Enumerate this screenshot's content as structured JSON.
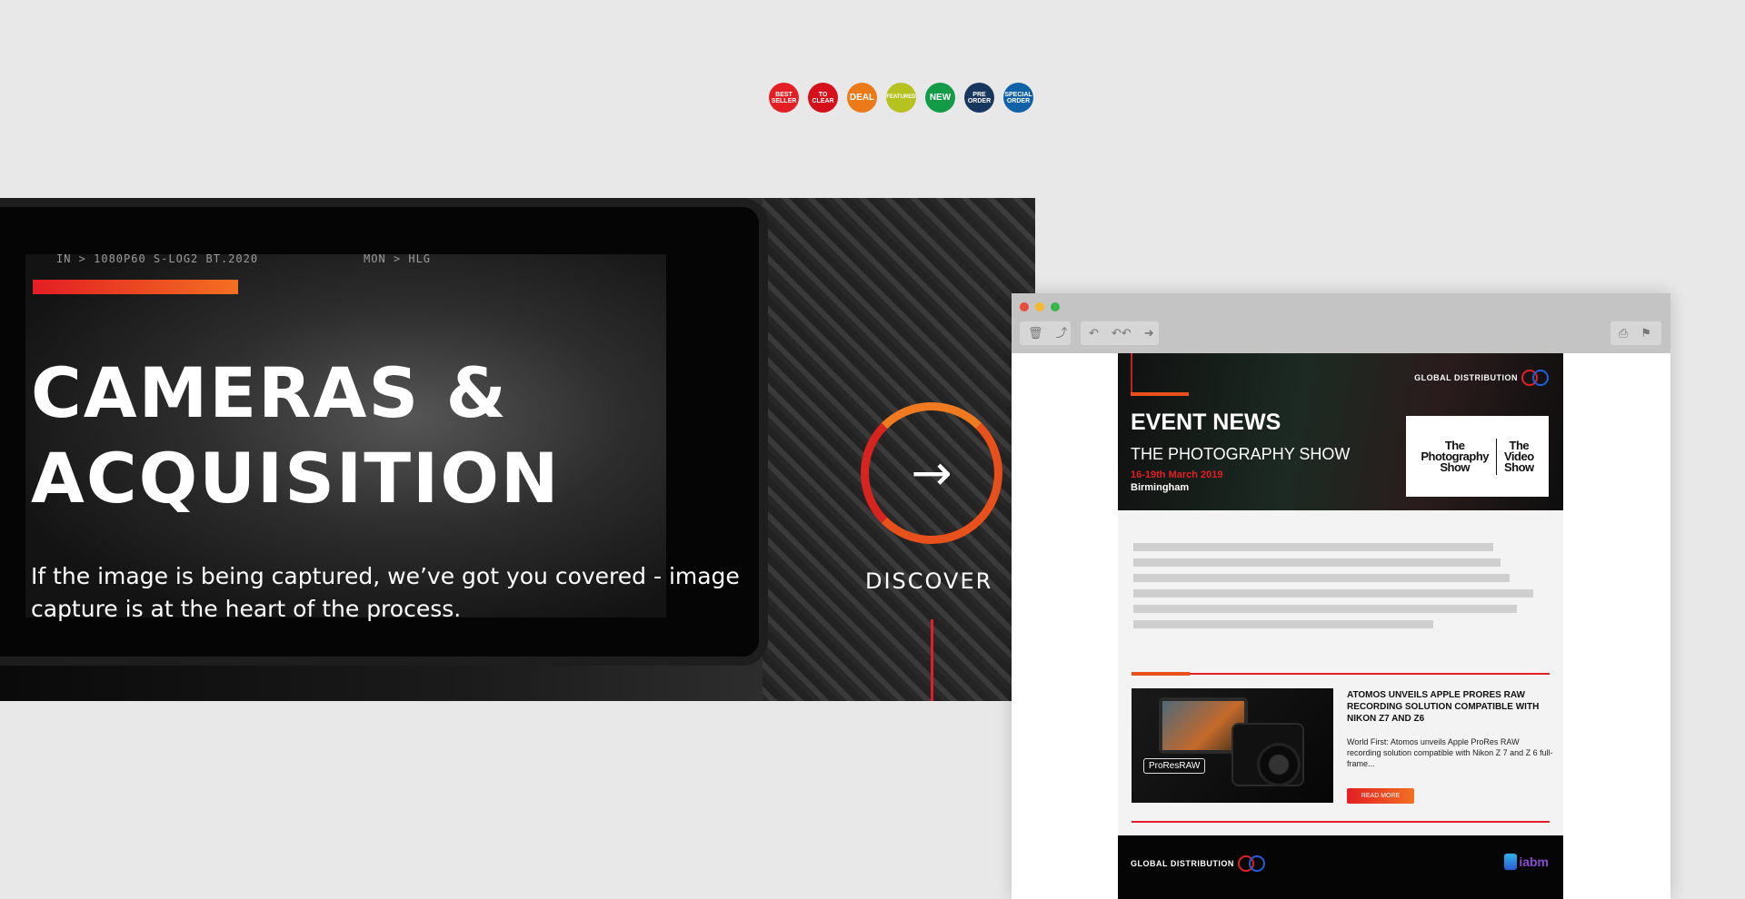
{
  "badges": [
    {
      "label": "BEST\nSELLER",
      "color": "#e31e24",
      "size": "small"
    },
    {
      "label": "TO\nCLEAR",
      "color": "#d6101b",
      "size": "small"
    },
    {
      "label": "DEAL",
      "color": "#ec7a18",
      "size": "big"
    },
    {
      "label": "FEATURED",
      "color": "#b5c21f",
      "size": "small"
    },
    {
      "label": "NEW",
      "color": "#139b48",
      "size": "big"
    },
    {
      "label": "PRE\nORDER",
      "color": "#17375e",
      "size": "small"
    },
    {
      "label": "SPECIAL\nORDER",
      "color": "#0f62a8",
      "size": "small"
    }
  ],
  "hero": {
    "osd_format": "IN  > 1080P60 S-LOG2 BT.2020",
    "osd_mon": "MON   > HLG",
    "heading_line1": "CAMERAS &",
    "heading_line2": "ACQUISITION",
    "subtext": "If the image is being captured, we’ve got you covered - image capture is at the heart of the process.",
    "discover_label": "DISCOVER",
    "arrow_glyph": "→",
    "accent_colors": [
      "#e31e24",
      "#f37021"
    ]
  },
  "mail_window": {
    "traffic_lights": [
      "#e94b3c",
      "#f5b82e",
      "#39b54a"
    ],
    "toolbar_left": [
      "🗑",
      "⤴"
    ],
    "toolbar_nav": [
      "↶",
      "↶↶",
      "➜"
    ],
    "toolbar_right": [
      "⎙",
      "⚑"
    ],
    "newsletter": {
      "brand": "GLOBAL DISTRIBUTION",
      "title": "EVENT NEWS",
      "event_name": "THE PHOTOGRAPHY SHOW",
      "event_date": "16-19th March 2019",
      "event_city": "Birmingham",
      "show_logo_1": "The\nPhotography\nShow",
      "show_logo_2": "The\nVideo\nShow",
      "story": {
        "image_tag": "ProResRAW",
        "title": "ATOMOS UNVEILS APPLE PRORES RAW RECORDING SOLUTION COMPATIBLE WITH NIKON Z7 AND Z6",
        "text": "World First: Atomos unveils Apple ProRes RAW recording solution compatible with Nikon Z 7 and Z 6 full-frame...",
        "read_more": "READ MORE"
      },
      "footer_brand": "GLOBAL DISTRIBUTION",
      "footer_partner": "iabm"
    }
  }
}
